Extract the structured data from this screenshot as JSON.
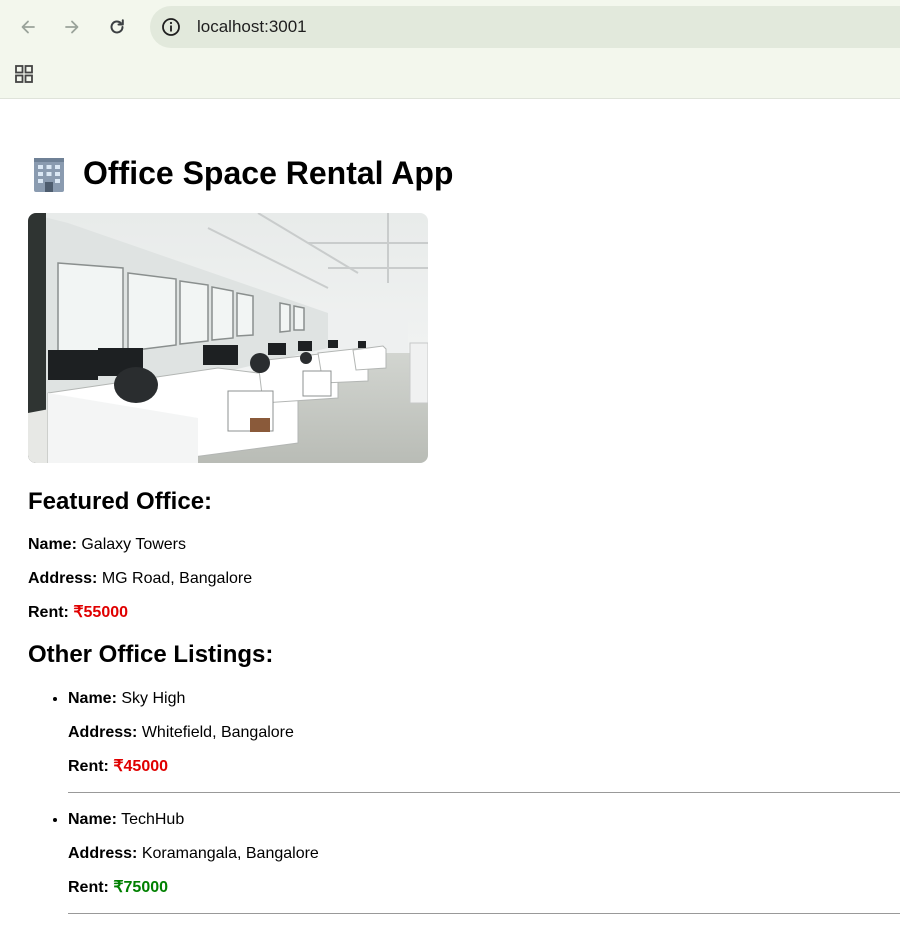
{
  "browser": {
    "url": "localhost:3001",
    "icons": {
      "back": "arrow-left-icon",
      "forward": "arrow-right-icon",
      "reload": "reload-icon",
      "info": "info-icon",
      "apps": "apps-grid-icon"
    }
  },
  "app": {
    "title": "Office Space Rental App",
    "title_icon": "office-building-icon"
  },
  "featured": {
    "heading": "Featured Office:",
    "name_label": "Name:",
    "name": "Galaxy Towers",
    "address_label": "Address:",
    "address": "MG Road, Bangalore",
    "rent_label": "Rent:",
    "rent": "₹55000",
    "rent_color": "#e00000"
  },
  "listings": {
    "heading": "Other Office Listings:",
    "items": [
      {
        "name_label": "Name:",
        "name": "Sky High",
        "address_label": "Address:",
        "address": "Whitefield, Bangalore",
        "rent_label": "Rent:",
        "rent": "₹45000",
        "rent_color": "#e00000"
      },
      {
        "name_label": "Name:",
        "name": "TechHub",
        "address_label": "Address:",
        "address": "Koramangala, Bangalore",
        "rent_label": "Rent:",
        "rent": "₹75000",
        "rent_color": "#008000"
      }
    ]
  }
}
